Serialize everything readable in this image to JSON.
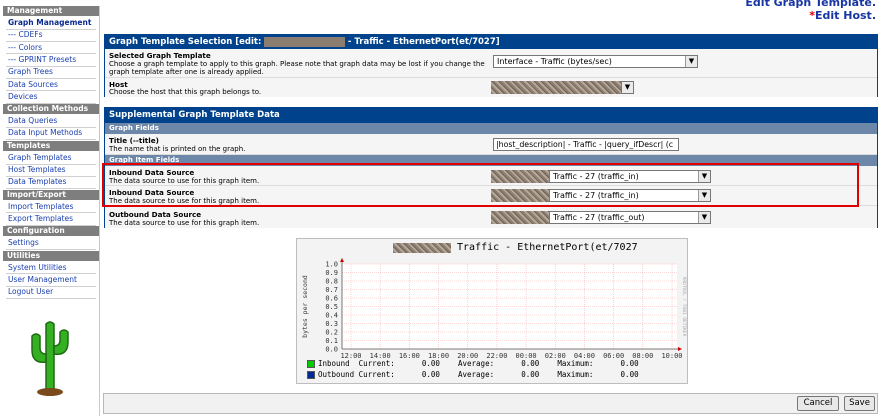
{
  "top_links": {
    "line1": "Edit Graph Template.",
    "line2_star": "*",
    "line2": "Edit Host."
  },
  "sidebar": {
    "groups": [
      {
        "header": "Management",
        "items": [
          "Graph Management",
          "--- CDEFs",
          "--- Colors",
          "--- GPRINT Presets",
          "Graph Trees",
          "Data Sources",
          "Devices"
        ]
      },
      {
        "header": "Collection Methods",
        "items": [
          "Data Queries",
          "Data Input Methods"
        ]
      },
      {
        "header": "Templates",
        "items": [
          "Graph Templates",
          "Host Templates",
          "Data Templates"
        ]
      },
      {
        "header": "Import/Export",
        "items": [
          "Import Templates",
          "Export Templates"
        ]
      },
      {
        "header": "Configuration",
        "items": [
          "Settings"
        ]
      },
      {
        "header": "Utilities",
        "items": [
          "System Utilities",
          "User Management",
          "Logout User"
        ]
      }
    ]
  },
  "template_panel": {
    "title_prefix": "Graph Template Selection [edit: ",
    "title_suffix": " - Traffic - EthernetPort(et/7027]",
    "selected_label": "Selected Graph Template",
    "selected_desc1": "Choose a graph template to apply to this graph. Please note that graph data may be lost if you change the",
    "selected_desc2": "graph template after one is already applied.",
    "selected_value": "Interface - Traffic (bytes/sec)",
    "host_label": "Host",
    "host_desc": "Choose the host that this graph belongs to."
  },
  "supplemental_panel": {
    "title": "Supplemental Graph Template Data",
    "graph_fields_header": "Graph Fields",
    "title_field_label": "Title (--title)",
    "title_field_desc": "The name that is printed on the graph.",
    "title_field_value": "|host_description| - Traffic - |query_ifDescr| (c",
    "item_fields_header": "Graph Item Fields",
    "inbound1_label": "Inbound Data Source",
    "inbound1_desc": "The data source to use for this graph item.",
    "inbound1_value": "Traffic - 27 (traffic_in)",
    "inbound2_label": "Inbound Data Source",
    "inbound2_desc": "The data source to use for this graph item.",
    "inbound2_value": "Traffic - 27 (traffic_in)",
    "outbound_label": "Outbound Data Source",
    "outbound_desc": "The data source to use for this graph item.",
    "outbound_value": "Traffic - 27 (traffic_out)"
  },
  "graph": {
    "title": "Traffic - EthernetPort(et/7027",
    "side_text": "RRDTOOL / TOBI OETIKER",
    "ylabel": "bytes per second",
    "legend": [
      {
        "name": "Inbound",
        "color": "#00cc00",
        "text": "  Current:      0.00    Average:      0.00    Maximum:      0.00"
      },
      {
        "name": "Outbound",
        "color": "#002a97",
        "text": " Current:      0.00    Average:      0.00    Maximum:      0.00"
      }
    ]
  },
  "chart_data": {
    "type": "line",
    "xlabel": "",
    "ylabel": "bytes per second",
    "x_ticks": [
      "12:00",
      "14:00",
      "16:00",
      "18:00",
      "20:00",
      "22:00",
      "00:00",
      "02:00",
      "04:00",
      "06:00",
      "08:00",
      "10:00"
    ],
    "y_ticks": [
      "0.0",
      "0.1",
      "0.2",
      "0.3",
      "0.4",
      "0.5",
      "0.6",
      "0.7",
      "0.8",
      "0.9",
      "1.0"
    ],
    "ylim": [
      0,
      1.0
    ],
    "grid": true,
    "series": [
      {
        "name": "Inbound",
        "values": []
      },
      {
        "name": "Outbound",
        "values": []
      }
    ]
  },
  "buttons": {
    "cancel": "Cancel",
    "save": "Save"
  }
}
